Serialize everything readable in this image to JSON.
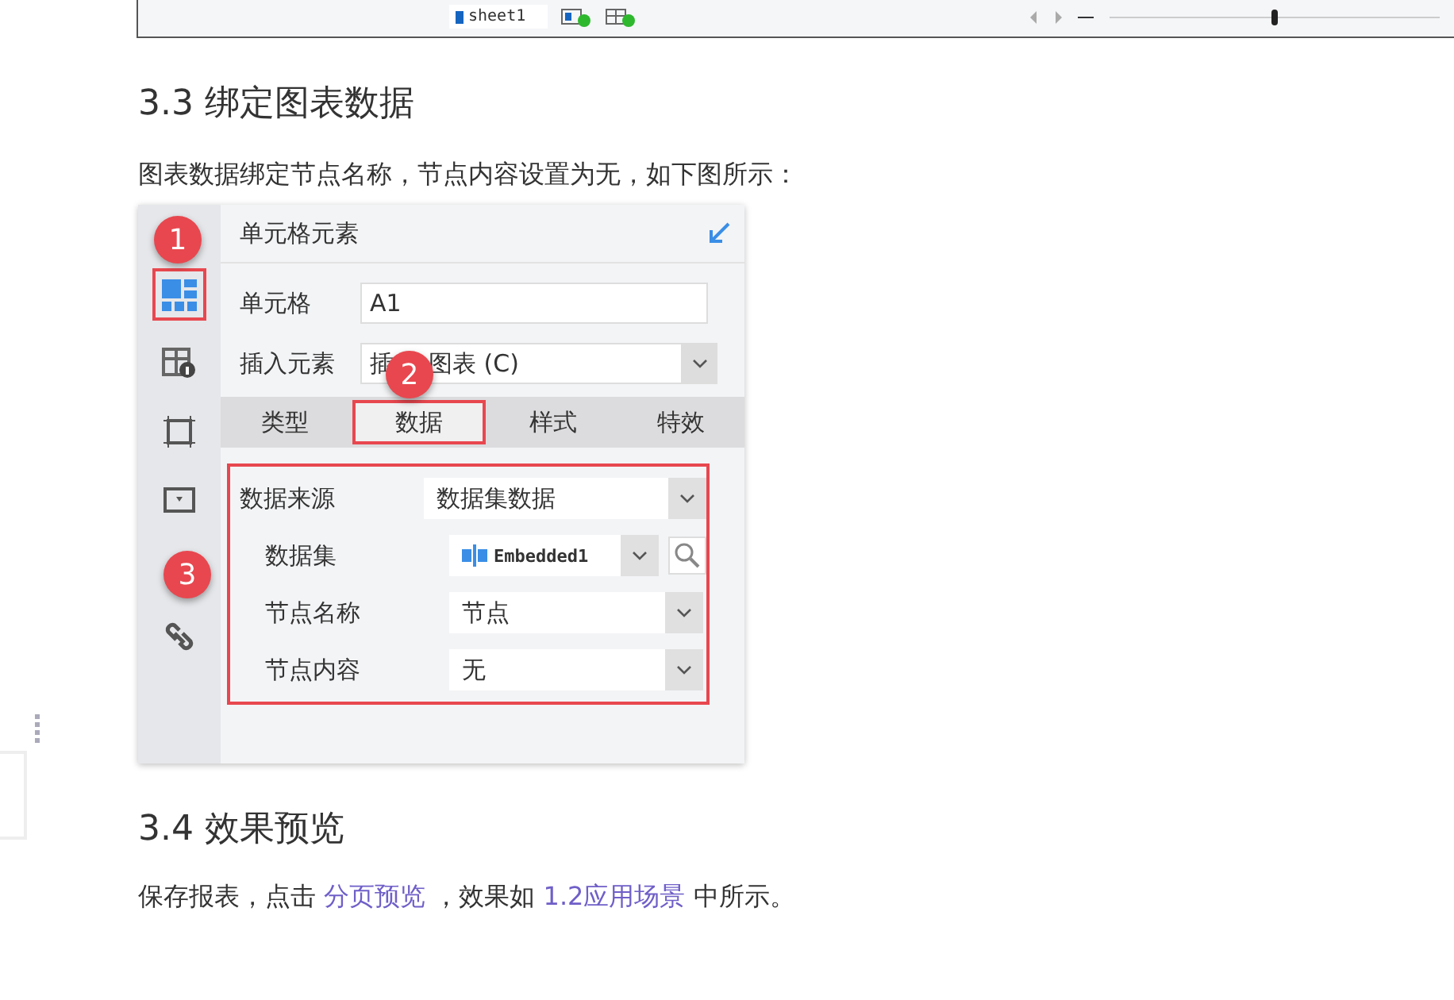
{
  "top_window": {
    "sheet_tab": "sheet1",
    "zoom": {
      "level": 0.5
    }
  },
  "section_1": {
    "heading": "3.3 绑定图表数据",
    "intro": "图表数据绑定节点名称，节点内容设置为无，如下图所示："
  },
  "panel": {
    "title": "单元格元素",
    "sidebar": [
      {
        "kind": "grid",
        "selected": true
      },
      {
        "kind": "info",
        "selected": false
      },
      {
        "kind": "frame",
        "selected": false
      },
      {
        "kind": "dropdown",
        "selected": false
      },
      {
        "kind": "hidden",
        "selected": false
      },
      {
        "kind": "link",
        "selected": false
      }
    ],
    "cell_label": "单元格",
    "cell_value": "A1",
    "insert_label": "插入元素",
    "insert_value_start": "插",
    "insert_value_end": "图表 (C)",
    "tabs": [
      {
        "label": "类型",
        "selected": false
      },
      {
        "label": "数据",
        "selected": true
      },
      {
        "label": "样式",
        "selected": false
      },
      {
        "label": "特效",
        "selected": false
      }
    ],
    "fields": [
      {
        "label": "数据来源",
        "value": "数据集数据",
        "kind": "select",
        "indent": false
      },
      {
        "label": "数据集",
        "value": "Embedded1",
        "kind": "dataset",
        "indent": true
      },
      {
        "label": "节点名称",
        "value": "节点",
        "kind": "select",
        "indent": true
      },
      {
        "label": "节点内容",
        "value": "无",
        "kind": "select",
        "indent": true
      }
    ],
    "badges": [
      "1",
      "2",
      "3"
    ]
  },
  "section_2": {
    "heading": "3.4 效果预览",
    "text_1": "保存报表，点击",
    "link_1": "分页预览",
    "text_2": "，效果如",
    "link_2": "1.2应用场景",
    "text_3": "中所示。"
  }
}
